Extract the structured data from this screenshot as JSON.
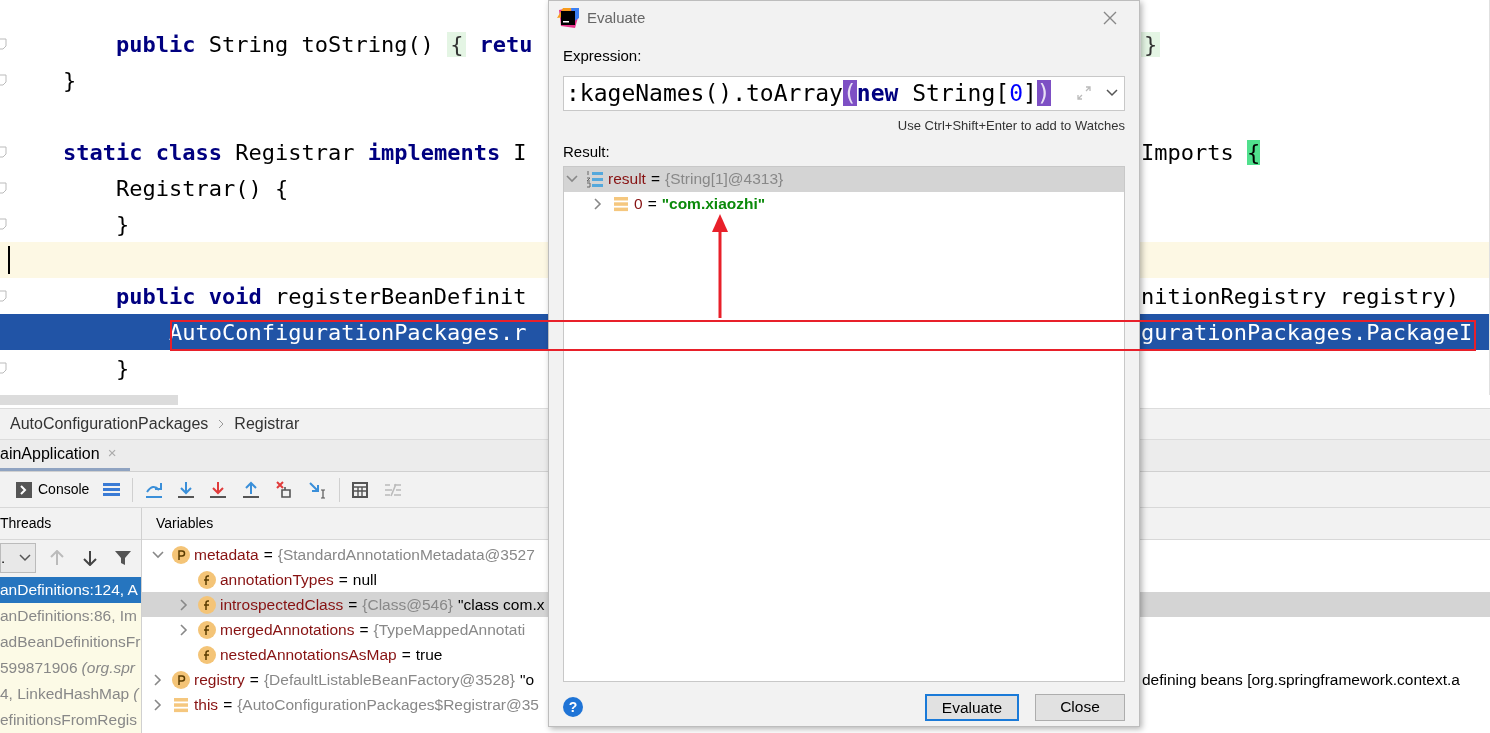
{
  "editor": {
    "lines": [
      {
        "kind": "plain",
        "fold": true,
        "left": [
          {
            "text": "    public",
            "kind": "keyword"
          },
          {
            "text": " String toString() "
          },
          {
            "text": "{",
            "kind": "brace"
          },
          {
            "text": " retu",
            "kind": "keyword"
          }
        ],
        "right": [
          {
            "text": "}",
            "kind": "brace"
          }
        ]
      },
      {
        "kind": "plain",
        "fold": true,
        "left": [
          {
            "text": "}"
          }
        ]
      },
      {
        "kind": "plain",
        "fold": false
      },
      {
        "kind": "plain",
        "fold": true,
        "left": [
          {
            "text": "static",
            "kind": "keyword"
          },
          {
            "text": " class",
            "kind": "keyword"
          },
          {
            "text": " Registrar "
          },
          {
            "text": "implements",
            "kind": "keyword"
          },
          {
            "text": " I"
          }
        ],
        "right": [
          {
            "text": "Imports "
          },
          {
            "text": "{",
            "kind": "match"
          }
        ]
      },
      {
        "kind": "plain",
        "fold": true,
        "left": [
          {
            "text": "    Registrar() {"
          }
        ]
      },
      {
        "kind": "plain",
        "fold": true,
        "left": [
          {
            "text": "    }"
          }
        ]
      },
      {
        "kind": "caret",
        "fold": false
      },
      {
        "kind": "plain",
        "fold": true,
        "left": [
          {
            "text": "    public",
            "kind": "keyword"
          },
          {
            "text": " void",
            "kind": "keyword"
          },
          {
            "text": " registerBeanDefinit"
          }
        ],
        "right": [
          {
            "text": "nitionRegistry registry)"
          }
        ]
      },
      {
        "kind": "execution",
        "fold": false,
        "left": [
          {
            "text": "        AutoConfigurationPackages.r"
          }
        ],
        "right": [
          {
            "text": "gurationPackages.PackageI"
          }
        ]
      },
      {
        "kind": "plain",
        "fold": true,
        "left": [
          {
            "text": "    }"
          }
        ]
      }
    ]
  },
  "breadcrumb": [
    "AutoConfigurationPackages",
    "Registrar"
  ],
  "debug_tab": {
    "label": "ainApplication",
    "close": "×"
  },
  "toolbar": {
    "console": "Console"
  },
  "threads": {
    "title": "Threads",
    "dropdown": ".",
    "frames": [
      {
        "text": "anDefinitions:124, A",
        "selected": true
      },
      {
        "text": "anDefinitions:86, Im",
        "selected": false
      },
      {
        "text": "adBeanDefinitionsFr",
        "selected": false
      },
      {
        "text": "599871906",
        "italic": "(org.spr",
        "selected": false
      },
      {
        "text": "4, LinkedHashMap",
        "italic": "(",
        "selected": false
      },
      {
        "text": "efinitionsFromRegis",
        "selected": false
      }
    ]
  },
  "variables": {
    "title": "Variables",
    "items": [
      {
        "kind": "parameter",
        "name": "metadata",
        "sign": "=",
        "ref": "{StandardAnnotationMetadata@3527",
        "expanded": true,
        "selected": false,
        "children": [
          {
            "kind": "field",
            "name": "annotationTypes",
            "sign": "=",
            "value": "null",
            "selected": false
          },
          {
            "kind": "field",
            "name": "introspectedClass",
            "sign": "=",
            "ref": "{Class@546}",
            "value": "\"class com.x",
            "expanded": false,
            "selected": true
          },
          {
            "kind": "field",
            "name": "mergedAnnotations",
            "sign": "=",
            "ref": "{TypeMappedAnnotati",
            "expanded": false,
            "selected": false
          },
          {
            "kind": "field",
            "name": "nestedAnnotationsAsMap",
            "sign": "=",
            "value": "true",
            "selected": false
          }
        ]
      },
      {
        "kind": "parameter",
        "name": "registry",
        "sign": "=",
        "ref": "{DefaultListableBeanFactory@3528}",
        "value": "\"o",
        "right": "defining beans [org.springframework.context.a",
        "expanded": false,
        "selected": false
      },
      {
        "kind": "local",
        "name": "this",
        "sign": "=",
        "ref": "{AutoConfigurationPackages$Registrar@35",
        "expanded": false,
        "selected": false
      }
    ]
  },
  "dialog": {
    "title": "Evaluate",
    "expression_label": "Expression:",
    "expression": [
      {
        "text": ":kageNames().toArray"
      },
      {
        "text": "(",
        "kind": "paren"
      },
      {
        "text": "new",
        "kind": "keyword"
      },
      {
        "text": " String["
      },
      {
        "text": "0",
        "kind": "number"
      },
      {
        "text": "]"
      },
      {
        "text": ")",
        "kind": "paren"
      }
    ],
    "hint": "Use Ctrl+Shift+Enter to add to Watches",
    "result_label": "Result:",
    "result": [
      {
        "kind": "array",
        "name": "result",
        "sign": "=",
        "ref": "{String[1]@4313}",
        "expanded": true,
        "selected": true,
        "children": [
          {
            "kind": "local",
            "name": "0",
            "sign": "=",
            "string": "\"com.xiaozhi\"",
            "expanded": false,
            "selected": false
          }
        ]
      }
    ],
    "help": "?",
    "buttons": [
      {
        "label": "Evaluate",
        "focused": true
      },
      {
        "label": "Close",
        "focused": false
      }
    ]
  }
}
